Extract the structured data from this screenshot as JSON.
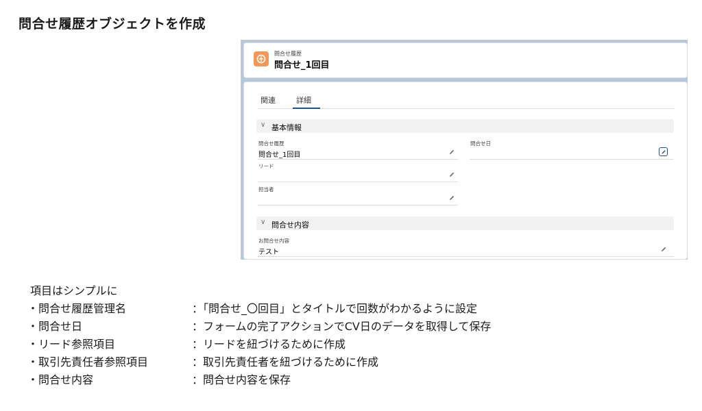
{
  "slide_title": "問合せ履歴オブジェクトを作成",
  "record": {
    "object_label": "問合せ履歴",
    "record_name": "問合せ_1回目",
    "accent_color": "#f49756"
  },
  "tabs": {
    "related": "関連",
    "detail": "詳細"
  },
  "sections": {
    "basic": {
      "title": "基本情報"
    },
    "inquiry": {
      "title": "問合せ内容"
    }
  },
  "fields": {
    "history": {
      "label": "問合せ履歴",
      "value": "問合せ_1回目"
    },
    "inquiry_date": {
      "label": "問合せ日",
      "value": ""
    },
    "lead": {
      "label": "リード",
      "value": ""
    },
    "owner": {
      "label": "担当者",
      "value": ""
    },
    "content": {
      "label": "お問合せ内容",
      "value": "テスト"
    }
  },
  "notes": {
    "heading": "項目はシンプルに",
    "items": [
      {
        "name": "・問合せ履歴管理名",
        "desc": "：「問合せ_〇回目」とタイトルで回数がわかるように設定"
      },
      {
        "name": "・問合せ日",
        "desc": "：フォームの完了アクションでCV日のデータを取得して保存"
      },
      {
        "name": "・リード参照項目",
        "desc": "：リードを紐づけるために作成"
      },
      {
        "name": "・取引先責任者参照項目",
        "desc": "：取引先責任者を紐づけるために作成"
      },
      {
        "name": "・問合せ内容",
        "desc": "：問合せ内容を保存"
      }
    ]
  }
}
